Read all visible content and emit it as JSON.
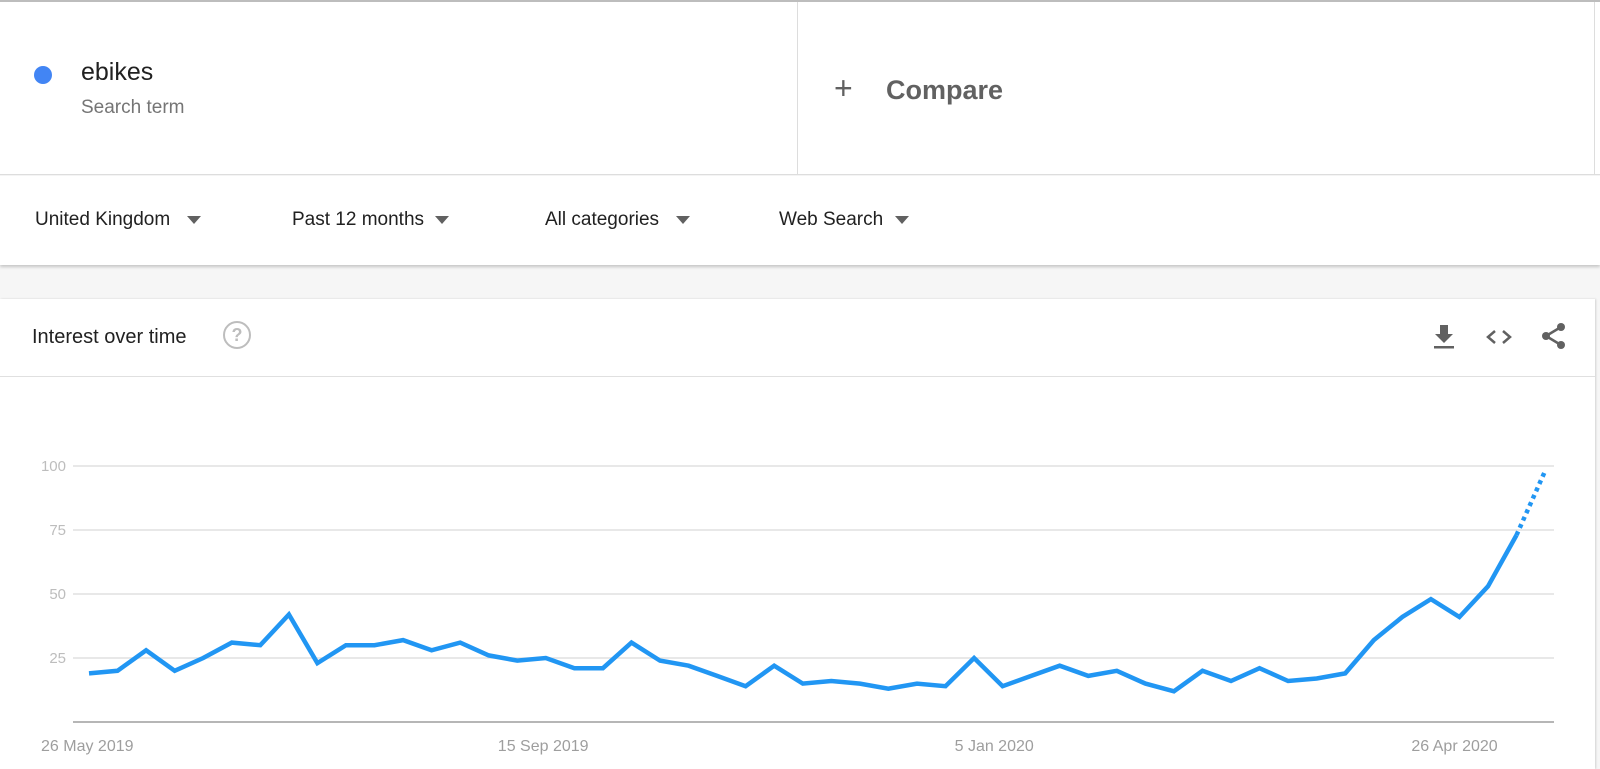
{
  "search": {
    "term": "ebikes",
    "term_type": "Search term",
    "term_color": "#4285f4",
    "compare_icon": "plus-icon",
    "compare_label": "Compare"
  },
  "filters": [
    {
      "label": "United Kingdom",
      "icon": "caret-down-icon"
    },
    {
      "label": "Past 12 months",
      "icon": "caret-down-icon"
    },
    {
      "label": "All categories",
      "icon": "caret-down-icon"
    },
    {
      "label": "Web Search",
      "icon": "caret-down-icon"
    }
  ],
  "card": {
    "title": "Interest over time",
    "help_icon": "help-circle-icon",
    "actions": [
      "download-icon",
      "embed-code-icon",
      "share-icon"
    ]
  },
  "chart_data": {
    "type": "line",
    "title": "Interest over time",
    "xlabel": "",
    "ylabel": "",
    "ylim": [
      0,
      100
    ],
    "yticks": [
      25,
      50,
      75,
      100
    ],
    "xtick_labels": [
      {
        "label": "26 May 2019",
        "index": 0
      },
      {
        "label": "15 Sep 2019",
        "index": 16
      },
      {
        "label": "5 Jan 2020",
        "index": 32
      },
      {
        "label": "26 Apr 2020",
        "index": 48
      }
    ],
    "grid": true,
    "legend": "none",
    "series": [
      {
        "name": "ebikes",
        "color": "#2196f3",
        "values": [
          19,
          20,
          28,
          20,
          25,
          31,
          30,
          42,
          23,
          30,
          30,
          32,
          28,
          31,
          26,
          24,
          25,
          21,
          21,
          31,
          24,
          22,
          18,
          14,
          22,
          15,
          16,
          15,
          13,
          15,
          14,
          25,
          14,
          18,
          22,
          18,
          20,
          15,
          12,
          20,
          16,
          21,
          16,
          17,
          19,
          32,
          41,
          48,
          41,
          53,
          73,
          98
        ],
        "partial_last_point": true
      }
    ]
  }
}
